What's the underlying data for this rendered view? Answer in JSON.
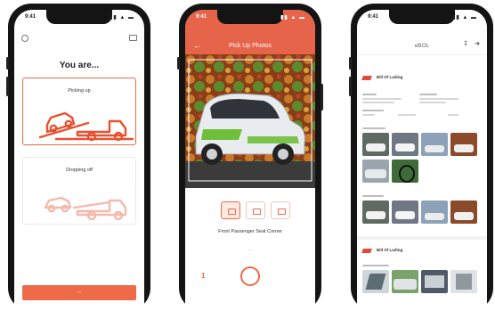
{
  "phone1": {
    "status_time": "9:41",
    "title": "You are...",
    "options": [
      {
        "label": "Picking up",
        "selected": true
      },
      {
        "label": "Dropping off",
        "selected": false
      }
    ],
    "continue_label": "—"
  },
  "phone2": {
    "status_time": "9:41",
    "title": "Pick Up Photos",
    "caption": "Front Passenger Seat Corner",
    "link": "—",
    "counter": "1"
  },
  "phone3": {
    "status_time": "9:41",
    "title": "eBOL",
    "bills": [
      {
        "title": "Bill Of Lading"
      },
      {
        "title": "Bill Of Lading"
      }
    ]
  },
  "colors": {
    "accent": "#ee6a48",
    "header": "#e6644a",
    "logo": "#e24a3a"
  }
}
